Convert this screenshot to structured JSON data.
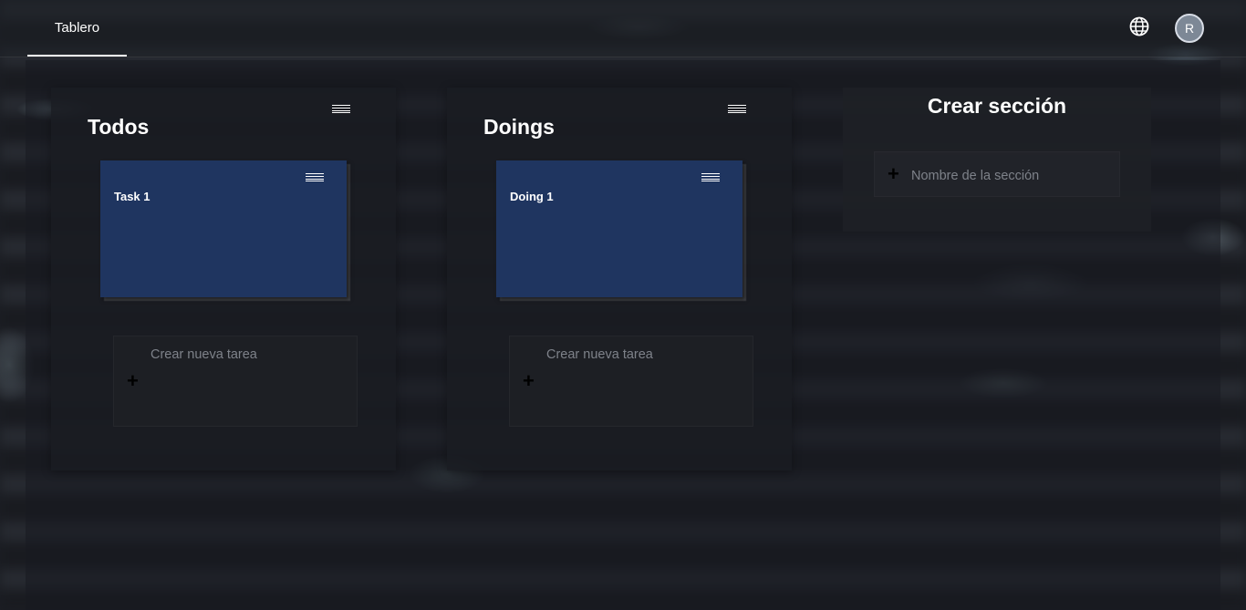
{
  "header": {
    "tab_label": "Tablero",
    "language_icon": "globe-icon",
    "avatar_initial": "R"
  },
  "sections": [
    {
      "title": "Todos",
      "tasks": [
        {
          "title": "Task 1"
        }
      ],
      "new_task_placeholder": "Crear nueva tarea"
    },
    {
      "title": "Doings",
      "tasks": [
        {
          "title": "Doing 1"
        }
      ],
      "new_task_placeholder": "Crear nueva tarea"
    }
  ],
  "create_section": {
    "title": "Crear sección",
    "placeholder": "Nombre de la sección"
  },
  "colors": {
    "task_card": "#1f3560",
    "panel": "#1a1c22",
    "tab_indicator": "#ffffff"
  }
}
